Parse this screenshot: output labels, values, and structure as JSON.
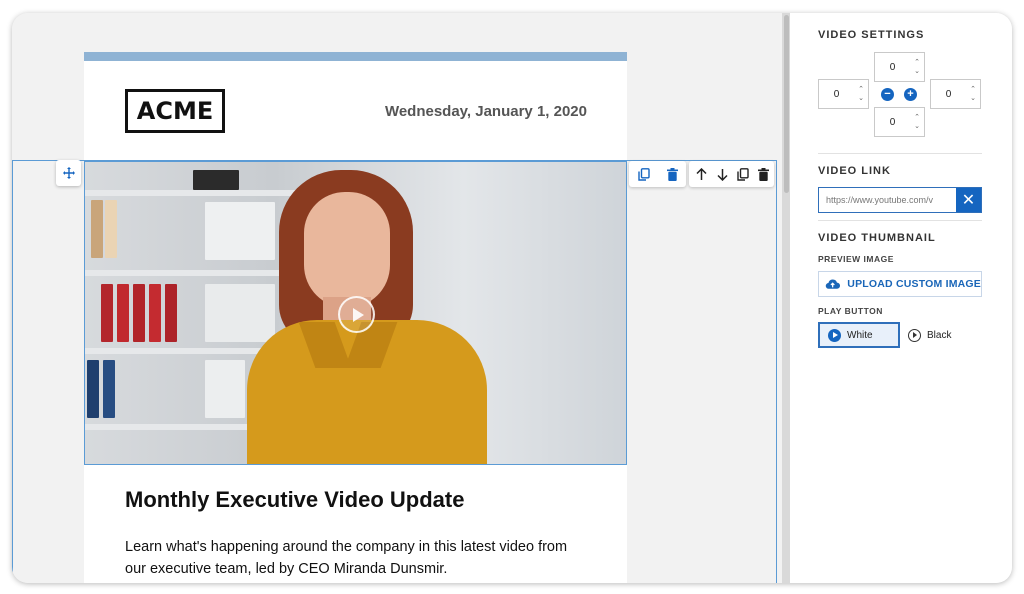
{
  "email": {
    "logo_text": "ACME",
    "date": "Wednesday, January 1, 2020",
    "heading": "Monthly Executive Video Update",
    "body": "Learn what's happening around the company in this latest video from our executive team, led by CEO Miranda Dunsmir."
  },
  "block_toolbar": {
    "left_group": [
      "copy-icon",
      "trash-icon"
    ],
    "right_group": [
      "arrow-up-icon",
      "arrow-down-icon",
      "copy-icon",
      "trash-icon"
    ]
  },
  "settings": {
    "video_settings_title": "VIDEO SETTINGS",
    "padding": {
      "top": "0",
      "right": "0",
      "bottom": "0",
      "left": "0"
    },
    "video_link_title": "VIDEO LINK",
    "video_link_value": "https://www.youtube.com/v",
    "video_thumbnail_title": "VIDEO THUMBNAIL",
    "preview_image_label": "PREVIEW IMAGE",
    "upload_label": "UPLOAD CUSTOM IMAGE",
    "play_button_label": "PLAY BUTTON",
    "play_options": [
      {
        "label": "White",
        "selected": true
      },
      {
        "label": "Black",
        "selected": false
      }
    ]
  },
  "colors": {
    "accent": "#1565c0",
    "selection": "#5b9bd5",
    "email_topbar": "#8fb3d4"
  }
}
